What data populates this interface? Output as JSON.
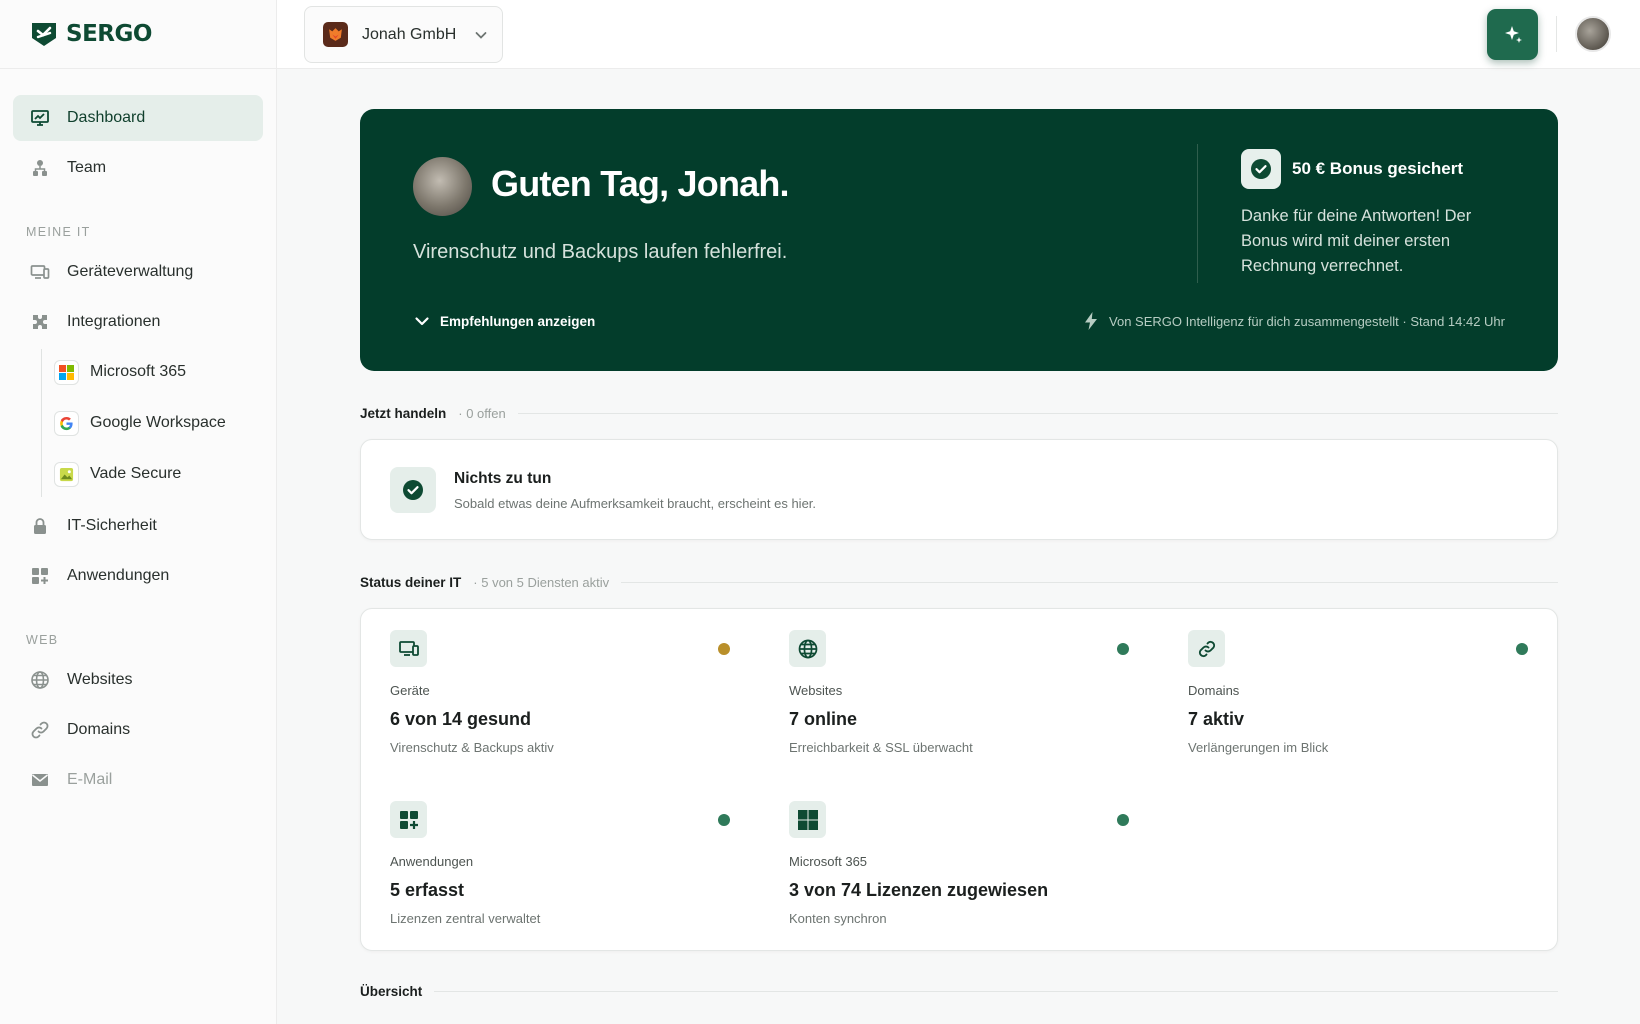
{
  "brand": {
    "name": "SERGO"
  },
  "colors": {
    "brand_dark": "#033d2b",
    "accent": "#1f6a4e",
    "status_ok": "#2f7a5a",
    "status_warn": "#b98f2a"
  },
  "sidebar": {
    "dashboard": "Dashboard",
    "team": "Team",
    "section_meine_it": "MEINE IT",
    "geraete": "Geräteverwaltung",
    "integrationen": "Integrationen",
    "sub": [
      {
        "label": "Microsoft 365",
        "icon": "microsoft-logo-icon"
      },
      {
        "label": "Google Workspace",
        "icon": "google-logo-icon"
      },
      {
        "label": "Vade Secure",
        "icon": "vade-logo-icon"
      }
    ],
    "sicherheit": "IT-Sicherheit",
    "anwendungen": "Anwendungen",
    "section_web": "WEB",
    "websites": "Websites",
    "domains": "Domains",
    "email": "E-Mail"
  },
  "topbar": {
    "org": "Jonah GmbH"
  },
  "hero": {
    "title": "Guten Tag, Jonah.",
    "subtitle": "Virenschutz und Backups laufen fehlerfrei.",
    "toggle": "Empfehlungen anzeigen",
    "bonus_title": "50 € Bonus gesichert",
    "bonus_text": "Danke für deine Antworten! Der Bonus wird mit deiner ersten Rechnung verrechnet.",
    "meta": "Von SERGO Intelligenz für dich zusammengestellt · Stand 14:42 Uhr"
  },
  "actions": {
    "title": "Jetzt handeln",
    "count": "· 0 offen",
    "empty_title": "Nichts zu tun",
    "empty_sub": "Sobald etwas deine Aufmerksamkeit braucht, erscheint es hier."
  },
  "status": {
    "title": "Status deiner IT",
    "count": "· 5 von 5 Diensten aktiv",
    "tiles": [
      {
        "label": "Geräte",
        "value": "6 von 14 gesund",
        "sub": "Virenschutz & Backups aktiv",
        "icon": "monitor-icon",
        "dot": "#b98f2a"
      },
      {
        "label": "Websites",
        "value": "7 online",
        "sub": "Erreichbarkeit & SSL überwacht",
        "icon": "globe-icon",
        "dot": "#2f7a5a"
      },
      {
        "label": "Domains",
        "value": "7 aktiv",
        "sub": "Verlängerungen im Blick",
        "icon": "link-icon",
        "dot": "#2f7a5a"
      },
      {
        "label": "Anwendungen",
        "value": "5 erfasst",
        "sub": "Lizenzen zentral verwaltet",
        "icon": "apps-icon",
        "dot": "#2f7a5a"
      },
      {
        "label": "Microsoft 365",
        "value": "3 von 74 Lizenzen zugewiesen",
        "sub": "Konten synchron",
        "icon": "windows-icon",
        "dot": "#2f7a5a"
      }
    ]
  },
  "overview": {
    "title": "Übersicht"
  }
}
